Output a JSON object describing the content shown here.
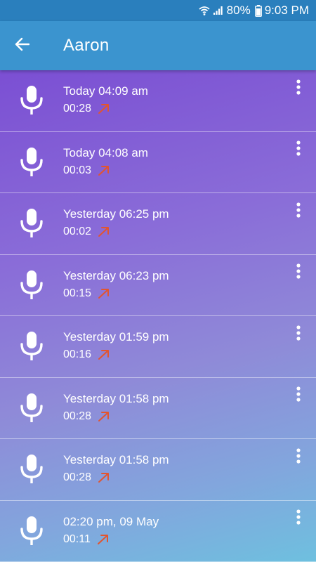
{
  "status_bar": {
    "battery": "80%",
    "time": "9:03 PM"
  },
  "app_bar": {
    "title": "Aaron",
    "back_icon": "arrow-left-icon"
  },
  "colors": {
    "status_bar": "#2a7fbd",
    "app_bar": "#3b94cf",
    "call_arrow": "#e2552f"
  },
  "recordings": [
    {
      "title": "Today 04:09 am",
      "duration": "00:28"
    },
    {
      "title": "Today 04:08 am",
      "duration": "00:03"
    },
    {
      "title": "Yesterday 06:25 pm",
      "duration": "00:02"
    },
    {
      "title": "Yesterday 06:23 pm",
      "duration": "00:15"
    },
    {
      "title": "Yesterday 01:59 pm",
      "duration": "00:16"
    },
    {
      "title": "Yesterday 01:58 pm",
      "duration": "00:28"
    },
    {
      "title": "Yesterday 01:58 pm",
      "duration": "00:28"
    },
    {
      "title": "02:20 pm, 09 May",
      "duration": "00:11"
    }
  ]
}
